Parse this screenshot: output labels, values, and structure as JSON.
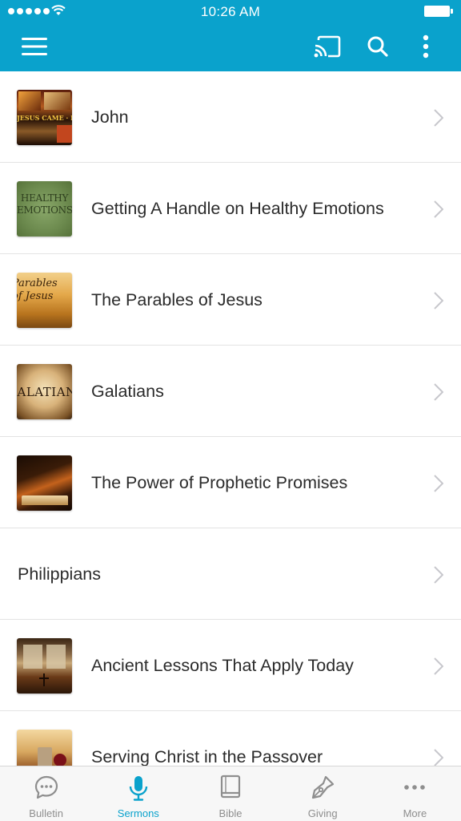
{
  "status_bar": {
    "time": "10:26 AM"
  },
  "app_bar": {
    "icons": [
      "menu-icon",
      "cast-icon",
      "search-icon",
      "more-vertical-icon"
    ],
    "color": "#0aa2cc"
  },
  "sermons": [
    {
      "title": "John",
      "thumbnail_text": "JESUS CAME · LIFE"
    },
    {
      "title": "Getting A Handle on Healthy Emotions",
      "thumbnail_text": "HEALTHY EMOTIONS"
    },
    {
      "title": "The Parables of Jesus",
      "thumbnail_text": "Parables of Jesus"
    },
    {
      "title": "Galatians",
      "thumbnail_text": "GALATIANS"
    },
    {
      "title": "The Power of Prophetic Promises",
      "thumbnail_text": ""
    },
    {
      "title": "Philippians",
      "thumbnail_text": ""
    },
    {
      "title": "Ancient Lessons That Apply Today",
      "thumbnail_text": ""
    },
    {
      "title": "Serving Christ in the Passover",
      "thumbnail_text": ""
    }
  ],
  "tabs": [
    {
      "label": "Bulletin",
      "icon": "chat-bubble-icon"
    },
    {
      "label": "Sermons",
      "icon": "microphone-icon",
      "active": true
    },
    {
      "label": "Bible",
      "icon": "book-icon"
    },
    {
      "label": "Giving",
      "icon": "pen-nib-icon"
    },
    {
      "label": "More",
      "icon": "more-horizontal-icon"
    }
  ],
  "colors": {
    "accent": "#0aa2cc",
    "inactive_tab": "#8e8e8e"
  }
}
